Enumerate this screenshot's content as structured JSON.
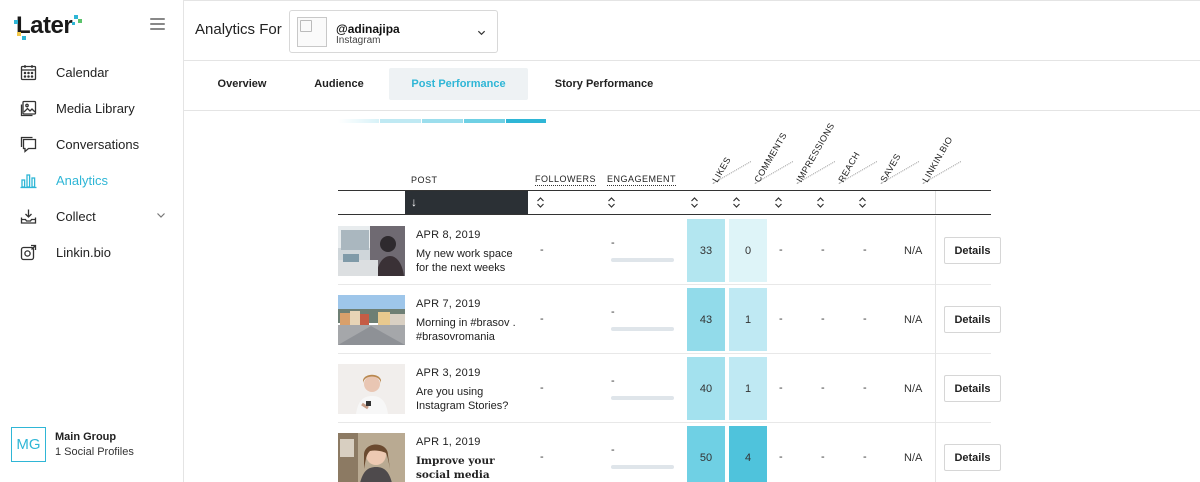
{
  "app": {
    "logo_text": "Later"
  },
  "sidebar": {
    "items": [
      {
        "label": "Calendar",
        "icon": "calendar-icon"
      },
      {
        "label": "Media Library",
        "icon": "image-icon"
      },
      {
        "label": "Conversations",
        "icon": "chat-icon"
      },
      {
        "label": "Analytics",
        "icon": "bar-chart-icon",
        "active": true
      },
      {
        "label": "Collect",
        "icon": "inbox-download-icon",
        "has_chevron": true
      },
      {
        "label": "Linkin.bio",
        "icon": "link-bio-icon"
      }
    ],
    "group": {
      "avatar": "MG",
      "name": "Main Group",
      "profiles": "1 Social Profiles"
    }
  },
  "header": {
    "label": "Analytics For",
    "account": {
      "handle": "@adinajipa",
      "network": "Instagram"
    }
  },
  "tabs": [
    {
      "label": "Overview"
    },
    {
      "label": "Audience"
    },
    {
      "label": "Post Performance",
      "active": true
    },
    {
      "label": "Story Performance"
    }
  ],
  "table": {
    "headers": {
      "post": "POST",
      "followers": "FOLLOWERS",
      "engagement": "ENGAGEMENT",
      "likes": "LIKES",
      "comments": "COMMENTS",
      "impressions": "IMPRESSIONS",
      "reach": "REACH",
      "saves": "SAVES",
      "linkinbio": "LINKIN.BIO"
    },
    "sort_arrow": "↓",
    "rows": [
      {
        "date": "APR 8, 2019",
        "caption": "My new work space for the next weeks",
        "followers": "-",
        "engagement": "-",
        "likes": "33",
        "comments": "0",
        "impressions": "-",
        "reach": "-",
        "saves": "-",
        "linkinbio": "N/A",
        "details": "Details"
      },
      {
        "date": "APR 7, 2019",
        "caption": "Morning in #brasov . #brasovromania",
        "followers": "-",
        "engagement": "-",
        "likes": "43",
        "comments": "1",
        "impressions": "-",
        "reach": "-",
        "saves": "-",
        "linkinbio": "N/A",
        "details": "Details"
      },
      {
        "date": "APR 3, 2019",
        "caption": "Are you using Instagram Stories?",
        "followers": "-",
        "engagement": "-",
        "likes": "40",
        "comments": "1",
        "impressions": "-",
        "reach": "-",
        "saves": "-",
        "linkinbio": "N/A",
        "details": "Details"
      },
      {
        "date": "APR 1, 2019",
        "caption": "Improve your social media presence👇 .",
        "followers": "-",
        "engagement": "-",
        "likes": "50",
        "comments": "4",
        "impressions": "-",
        "reach": "-",
        "saves": "-",
        "linkinbio": "N/A",
        "details": "Details"
      }
    ]
  },
  "colors": {
    "accent": "#2fb6d6",
    "likes_low": "#b3e6f0",
    "likes_high": "#6fd0e4",
    "comments_low": "#def4f8",
    "comments_high": "#4fc3dc"
  }
}
